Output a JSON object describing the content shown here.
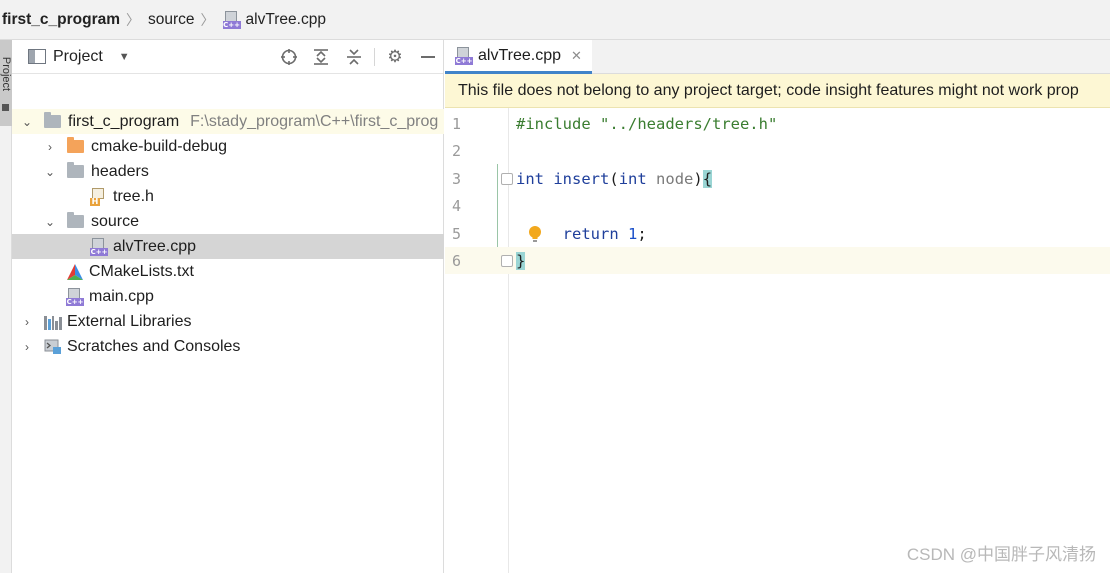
{
  "breadcrumb": {
    "project": "first_c_program",
    "folder": "source",
    "file": "alvTree.cpp"
  },
  "tool_window": {
    "stripe_label": "Project"
  },
  "project_panel": {
    "title": "Project",
    "tree": {
      "root_name": "first_c_program",
      "root_path": "F:\\stady_program\\C++\\first_c_prog",
      "cmake_build": "cmake-build-debug",
      "headers": "headers",
      "tree_h": "tree.h",
      "source": "source",
      "alvtree_cpp": "alvTree.cpp",
      "cmakelists": "CMakeLists.txt",
      "main_cpp": "main.cpp",
      "external_libraries": "External Libraries",
      "scratches": "Scratches and Consoles"
    }
  },
  "editor": {
    "tab_label": "alvTree.cpp",
    "banner": "This file does not belong to any project target; code insight features might not work prop",
    "line_numbers": [
      "1",
      "2",
      "3",
      "4",
      "5",
      "6"
    ],
    "code": {
      "include_kw": "#include",
      "include_path": "\"../headers/tree.h\"",
      "int_kw": "int",
      "fn_name": "insert",
      "paren_open": "(",
      "param_type": "int",
      "param_name": "node",
      "paren_close": ")",
      "brace_open": "{",
      "return_kw": "return",
      "return_val": "1",
      "semicolon": ";",
      "brace_close": "}"
    }
  },
  "watermark": "CSDN @中国胖子风清扬",
  "colors": {
    "accent_tab": "#4083c9",
    "banner_bg": "#fdf7d4",
    "selected_row": "#d5d5d5",
    "keyword": "#1f3f9b",
    "string": "#3a7d30"
  }
}
